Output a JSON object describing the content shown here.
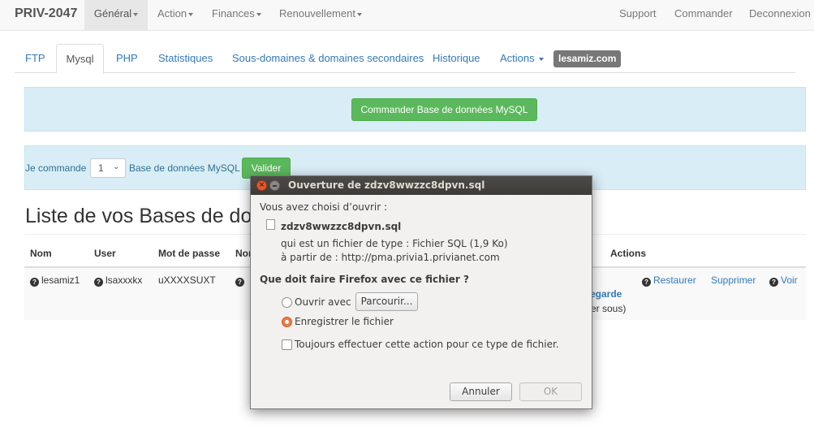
{
  "navbar": {
    "brand": "PRIV-2047",
    "menus": [
      "Général",
      "Action",
      "Finances",
      "Renouvellement"
    ],
    "right_links": [
      "Support",
      "Commander",
      "Deconnexion"
    ]
  },
  "tabs": [
    "FTP",
    "Mysql",
    "PHP",
    "Statistiques",
    "Sous-domaines & domaines secondaires",
    "Historique",
    "Actions"
  ],
  "domain_label": "lesamiz.com",
  "order_db_button": "Commander Base de données MySQL",
  "order_form": {
    "prefix": "Je commande",
    "quantity": "1",
    "suffix": "Base de données MySQL",
    "submit": "Valider"
  },
  "list_heading": "Liste de vos Bases de do",
  "table": {
    "headers": [
      "Nom",
      "User",
      "Mot de passe",
      "Nor",
      "Actions"
    ],
    "row": {
      "nom": "lesamiz1",
      "user": "lsaxxxkx",
      "password": "uXXXXSUXT",
      "partial_link": "egarde",
      "partial_text": "er sous)",
      "actions": [
        "Restaurer",
        "Supprimer",
        "Voir"
      ]
    }
  },
  "dialog": {
    "title": "Ouverture de zdzv8wwzzc8dpvn.sql",
    "intro": "Vous avez choisi d’ouvrir :",
    "filename": "zdzv8wwzzc8dpvn.sql",
    "type_line": "qui est un fichier de type : Fichier SQL (1,9 Ko)",
    "source_line": "à partir de : http://pma.privia1.privianet.com",
    "question": "Que doit faire Firefox avec ce fichier ?",
    "open_with_label": "Ouvrir avec",
    "browse_button": "Parcourir...",
    "save_label": "Enregistrer le fichier",
    "always_label": "Toujours effectuer cette action pour ce type de fichier.",
    "cancel_button": "Annuler",
    "ok_button": "OK"
  }
}
